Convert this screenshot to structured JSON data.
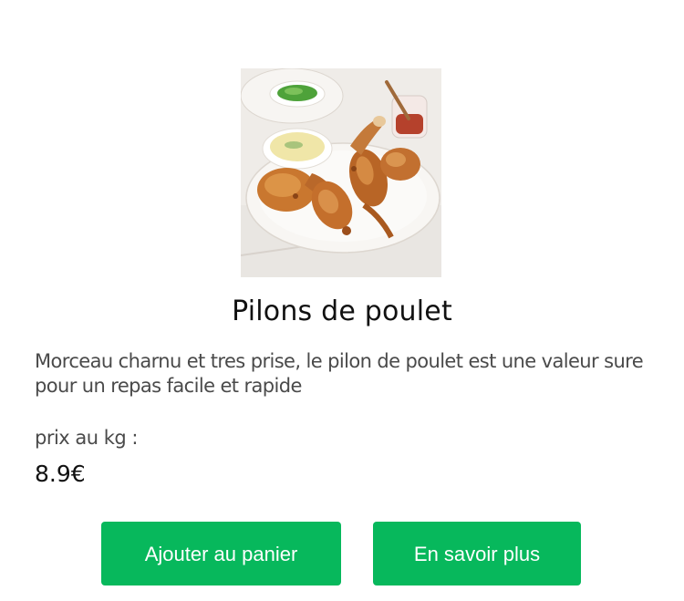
{
  "product": {
    "image_alt": "chicken-drumsticks-plate",
    "title": "Pilons de poulet",
    "description": "Morceau charnu et tres prise, le pilon de poulet est une valeur sure pour un repas facile et rapide",
    "price_label": "prix au kg :",
    "price_value": "8.9€"
  },
  "actions": {
    "add_to_cart_label": "Ajouter au panier",
    "learn_more_label": "En savoir plus"
  },
  "colors": {
    "button_bg": "#07b85c",
    "button_text": "#ffffff",
    "title_text": "#111111",
    "body_text": "#4a4a4a"
  }
}
